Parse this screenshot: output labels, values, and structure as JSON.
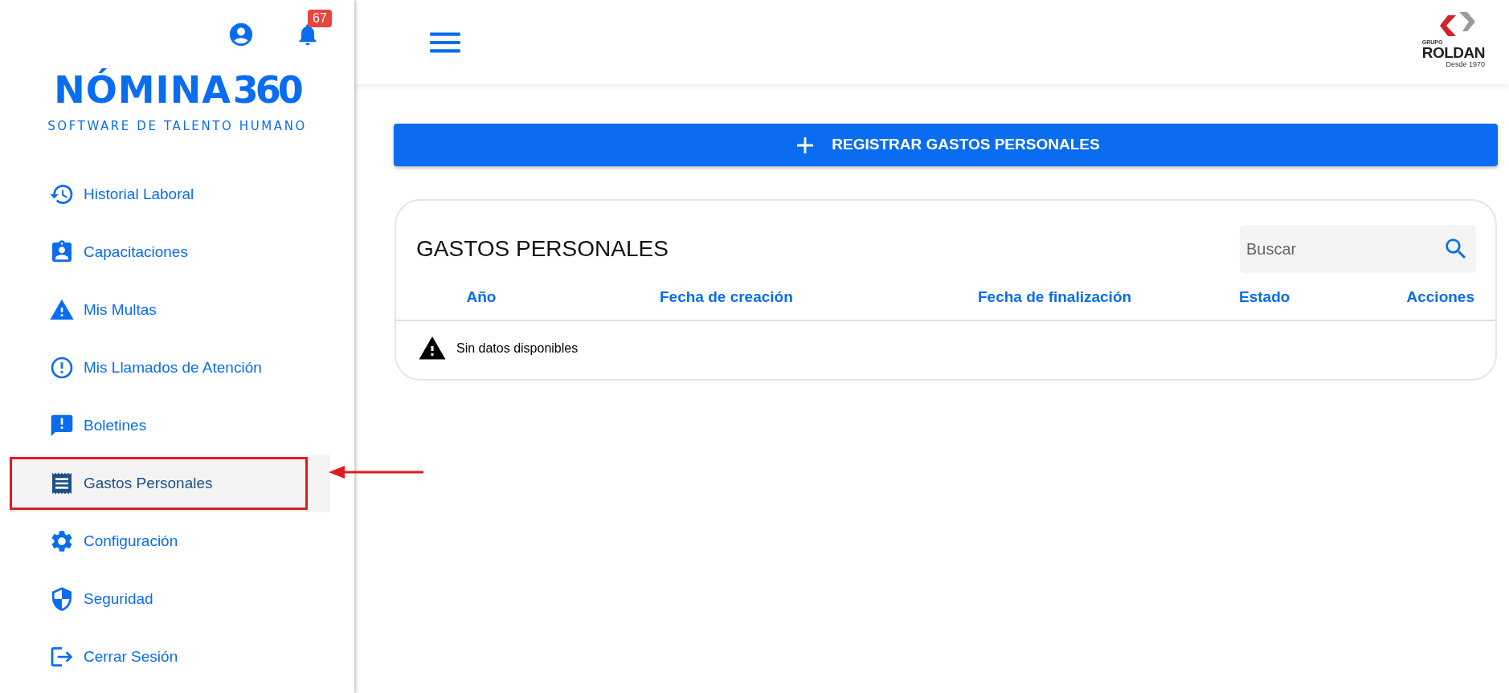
{
  "sidebar": {
    "notification_count": "67",
    "logo": {
      "name": "NÓMINA",
      "number": "360",
      "tagline": "SOFTWARE DE TALENTO HUMANO"
    },
    "items": [
      {
        "label": "Historial Laboral",
        "selected": false,
        "highlighted": false
      },
      {
        "label": "Capacitaciones",
        "selected": false,
        "highlighted": false
      },
      {
        "label": "Mis Multas",
        "selected": false,
        "highlighted": false
      },
      {
        "label": "Mis Llamados de Atención",
        "selected": false,
        "highlighted": false
      },
      {
        "label": "Boletines",
        "selected": false,
        "highlighted": false
      },
      {
        "label": "Gastos Personales",
        "selected": true,
        "highlighted": true
      },
      {
        "label": "Configuración",
        "selected": false,
        "highlighted": false
      },
      {
        "label": "Seguridad",
        "selected": false,
        "highlighted": false
      },
      {
        "label": "Cerrar Sesión",
        "selected": false,
        "highlighted": false
      }
    ]
  },
  "header": {
    "brand": {
      "top": "GRUPO",
      "name": "ROLDAN",
      "since": "Desde 1970"
    }
  },
  "register_button": "REGISTRAR GASTOS PERSONALES",
  "table": {
    "title": "GASTOS PERSONALES",
    "search": {
      "placeholder": "Buscar"
    },
    "columns": [
      "Año",
      "Fecha de creación",
      "Fecha de finalización",
      "Estado",
      "Acciones"
    ],
    "empty_message": "Sin datos disponibles"
  }
}
